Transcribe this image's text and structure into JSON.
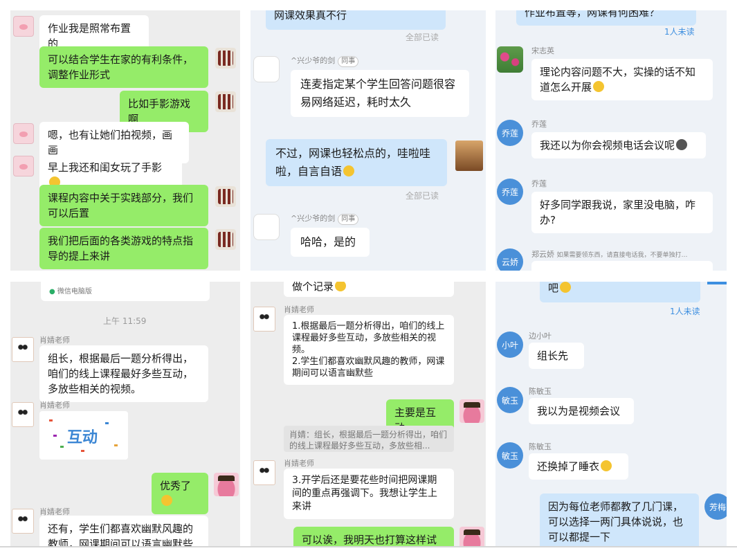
{
  "p1": {
    "m1": "作业我是照常布置的",
    "m2": "可以结合学生在家的有利条件，调整作业形式",
    "m3": "比如手影游戏啊",
    "m4": "嗯，也有让她们拍视频，画画",
    "m5": "早上我还和闺女玩了手影",
    "m6": "课程内容中关于实践部分，我们可以后置",
    "m7": "我们把后面的各类游戏的特点指导的提上来讲"
  },
  "p2": {
    "m0": "网课效果真不行",
    "read1": "全部已读",
    "sender": "^兴少爷的剑",
    "tag": "同事",
    "m1": "连麦指定某个学生回答问题很容易网络延迟，耗时太久",
    "m2": "不过，网课也轻松点的，哇啦哇啦，自言自语",
    "read2": "全部已读",
    "m3": "哈哈，是的"
  },
  "p3": {
    "m0": "作业布置等，网课有何困难？",
    "unread1": "1人未读",
    "s1": "宋志英",
    "m1": "理论内容问题不大，实操的话不知道怎么开展",
    "s2": "乔莲",
    "av2": "乔莲",
    "m2": "我还以为你会视频电话会议呢",
    "s3": "乔莲",
    "av3": "乔莲",
    "m3": "好多同学跟我说，家里没电脑，咋办?",
    "s4": "郑云娇",
    "s4note": "如果需要领东西，请直接电话我，不要单独打…",
    "av4": "云娇"
  },
  "p4": {
    "device": "微信电脑版",
    "time": "上午 11:59",
    "s1": "肖婧老师",
    "m1": "组长，根据最后一题分析得出，咱们的线上课程最好多些互动，多放些相关的视频。",
    "s2": "肖婧老师",
    "sticker": "互动",
    "m3": "优秀了",
    "s4": "肖婧老师",
    "m4": "还有，学生们都喜欢幽默风趣的教师，网课期间可以语言幽默些"
  },
  "p5": {
    "m0": "做个记录",
    "s1": "肖婧老师",
    "m1": "1.根据最后一题分析得出，咱们的线上课程最好多些互动，多放些相关的视频。\n2.学生们都喜欢幽默风趣的教师，网课期间可以语言幽默些",
    "m2": "主要是互动",
    "quote": "肖婧：组长，根据最后一题分析得出，咱们的线上课程最好多些互动，多放些相...",
    "s3": "肖婧老师",
    "m3": "3.开学后还是要花些时间把网课期间的重点再强调下。我想让学生上来讲",
    "m4": "可以诶，我明天也打算这样试下"
  },
  "p6": {
    "m0": "吧",
    "unread1": "1人未读",
    "s1": "边小叶",
    "av1": "小叶",
    "m1": "组长先",
    "s2": "陈敏玉",
    "av2": "敏玉",
    "m2": "我以为是视频会议",
    "s3": "陈敏玉",
    "av3": "敏玉",
    "m3": "还换掉了睡衣",
    "m4": "因为每位老师都教了几门课，可以选择一两门具体说说，也可以都提一下",
    "av4": "芳梅"
  },
  "colors": {
    "wechat_bg": "#ededed",
    "qq_bg": "#eef2f7",
    "green_bubble": "#95ec69",
    "blue_bubble": "#cfe6fb",
    "unread_blue": "#3d8fe0"
  }
}
